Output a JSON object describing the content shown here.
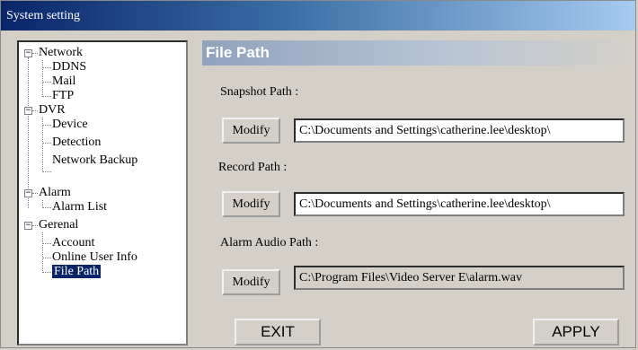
{
  "window": {
    "title": "System setting"
  },
  "tree": {
    "network": {
      "label": "Network",
      "children": [
        "DDNS",
        "Mail",
        "FTP"
      ]
    },
    "dvr": {
      "label": "DVR",
      "children": [
        "Device",
        "Detection",
        "Network Backup"
      ]
    },
    "alarm": {
      "label": "Alarm",
      "children": [
        "Alarm List"
      ]
    },
    "general": {
      "label": "Gerenal",
      "children": [
        "Account",
        "Online User Info",
        "File Path"
      ]
    },
    "selected": "File Path"
  },
  "panel": {
    "title": "File Path",
    "snapshot": {
      "label": "Snapshot Path :",
      "button": "Modify",
      "value": "C:\\Documents and Settings\\catherine.lee\\desktop\\"
    },
    "record": {
      "label": "Record Path :",
      "button": "Modify",
      "value": "C:\\Documents and Settings\\catherine.lee\\desktop\\"
    },
    "alarm_audio": {
      "label": "Alarm Audio Path :",
      "button": "Modify",
      "value": "C:\\Program Files\\Video Server E\\alarm.wav"
    },
    "exit_label": "EXIT",
    "apply_label": "APPLY"
  }
}
